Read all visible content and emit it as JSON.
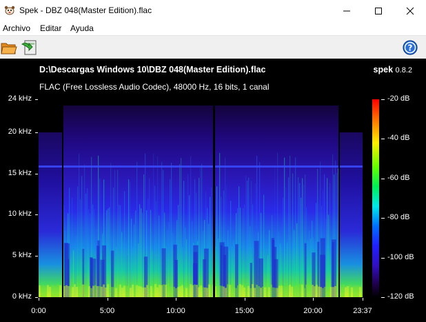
{
  "window": {
    "title": "Spek - DBZ 048(Master Edition).flac",
    "minimize_icon": "minimize-icon",
    "maximize_icon": "maximize-icon",
    "close_icon": "close-icon"
  },
  "menu": {
    "items": [
      "Archivo",
      "Editar",
      "Ayuda"
    ]
  },
  "toolbar": {
    "open_icon": "folder-open-icon",
    "save_icon": "save-image-icon",
    "help_icon": "help-icon"
  },
  "viewer": {
    "file_path": "D:\\Descargas Windows 10\\DBZ 048(Master Edition).flac",
    "file_info": "FLAC (Free Lossless Audio Codec), 48000 Hz, 16 bits, 1 canal",
    "brand_name": "spek",
    "brand_version": "0.8.2"
  },
  "chart_data": {
    "type": "heatmap",
    "title": "D:\\Descargas Windows 10\\DBZ 048(Master Edition).flac",
    "subtitle": "FLAC (Free Lossless Audio Codec), 48000 Hz, 16 bits, 1 canal",
    "xlabel": "",
    "ylabel": "",
    "x_ticks": [
      "0:00",
      "5:00",
      "10:00",
      "15:00",
      "20:00",
      "23:37"
    ],
    "x_tick_seconds": [
      0,
      300,
      600,
      900,
      1200,
      1417
    ],
    "xlim_seconds": [
      0,
      1417
    ],
    "y_ticks": [
      "0 kHz",
      "5 kHz",
      "10 kHz",
      "15 kHz",
      "20 kHz",
      "24 kHz"
    ],
    "y_tick_khz": [
      0,
      5,
      10,
      15,
      20,
      24
    ],
    "ylim_khz": [
      0,
      24
    ],
    "colorbar_ticks": [
      "-20 dB",
      "-40 dB",
      "-60 dB",
      "-80 dB",
      "-100 dB",
      "-120 dB"
    ],
    "colorbar_db": [
      -20,
      -40,
      -60,
      -80,
      -100,
      -120
    ],
    "colorbar_range_db": [
      -120,
      -20
    ],
    "colors": {
      "background": "#000000",
      "low": "#200050",
      "mid": "#2020ff",
      "high": "#00e8e8",
      "peak": "#ffee00"
    }
  }
}
